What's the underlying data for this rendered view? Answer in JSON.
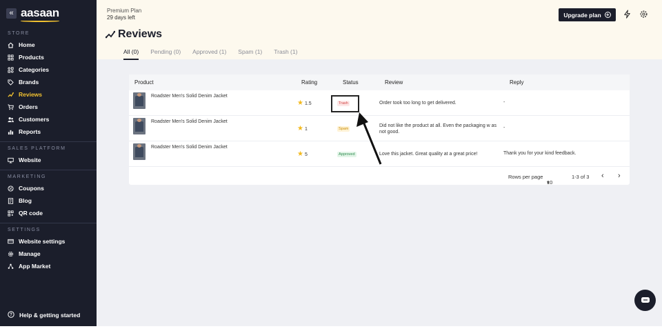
{
  "sidebar": {
    "logo": "aasaan",
    "collapse_icon": "«",
    "sections": {
      "store": "STORE",
      "sales": "SALES PLATFORM",
      "marketing": "MARKETING",
      "settings": "SETTINGS"
    },
    "store_items": [
      {
        "label": "Home",
        "icon": "home-icon"
      },
      {
        "label": "Products",
        "icon": "grid-icon"
      },
      {
        "label": "Categories",
        "icon": "categories-icon"
      },
      {
        "label": "Brands",
        "icon": "tag-icon"
      },
      {
        "label": "Reviews",
        "icon": "reviews-icon",
        "active": true
      },
      {
        "label": "Orders",
        "icon": "cart-icon"
      },
      {
        "label": "Customers",
        "icon": "users-icon"
      },
      {
        "label": "Reports",
        "icon": "bar-chart-icon"
      }
    ],
    "sales_items": [
      {
        "label": "Website",
        "icon": "monitor-icon"
      }
    ],
    "marketing_items": [
      {
        "label": "Coupons",
        "icon": "coupon-icon"
      },
      {
        "label": "Blog",
        "icon": "document-icon"
      },
      {
        "label": "QR code",
        "icon": "qr-icon"
      }
    ],
    "settings_items": [
      {
        "label": "Website settings",
        "icon": "website-settings-icon"
      },
      {
        "label": "Manage",
        "icon": "gear-icon"
      },
      {
        "label": "App Market",
        "icon": "apps-icon"
      }
    ],
    "help": "Help & getting started"
  },
  "header": {
    "plan_name": "Premium Plan",
    "days_left": "29 days left",
    "upgrade_label": "Upgrade plan",
    "page_title": "Reviews"
  },
  "tabs": [
    {
      "label": "All (0)",
      "active": true
    },
    {
      "label": "Pending (0)"
    },
    {
      "label": "Approved (1)"
    },
    {
      "label": "Spam (1)"
    },
    {
      "label": "Trash (1)"
    }
  ],
  "table": {
    "columns": {
      "product": "Product",
      "rating": "Rating",
      "status": "Status",
      "review": "Review",
      "reply": "Reply"
    },
    "rows": [
      {
        "product": "Roadster Men's Solid Denim Jacket",
        "rating": "1.5",
        "status": "Trash",
        "review": "Order took too long to get delivered.",
        "reply": "-"
      },
      {
        "product": "Roadster Men's Solid Denim Jacket",
        "rating": "1",
        "status": "Spam",
        "review": "Did not like the product at all. Even the packaging w as not good.",
        "reply": "-"
      },
      {
        "product": "Roadster Men's Solid Denim Jacket",
        "rating": "5",
        "status": "Approved",
        "review": "Love this jacket. Great quality at a great price!",
        "reply": "Thank you for your kind feedback."
      }
    ],
    "pagination": {
      "rows_per_page_label": "Rows per page",
      "rows_per_page_value": "10",
      "range": "1-3 of 3"
    }
  },
  "colors": {
    "sidebar_bg": "#1b1e2b",
    "accent": "#f2c230",
    "header_bg": "#fdf9ee"
  }
}
